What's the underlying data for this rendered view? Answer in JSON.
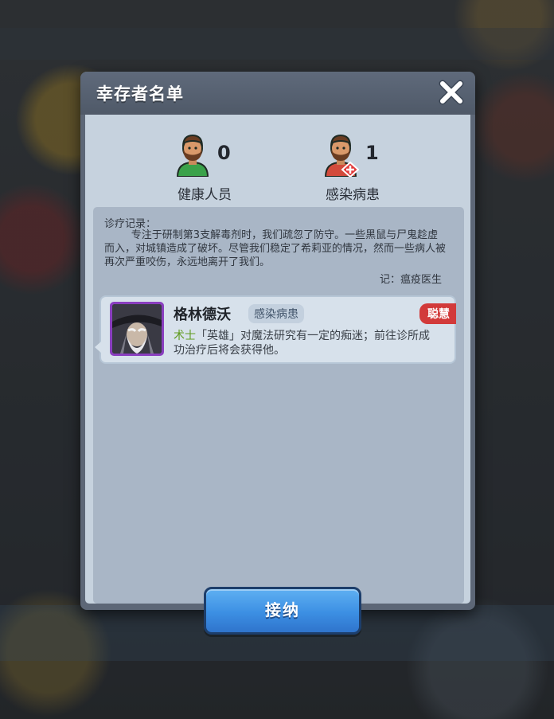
{
  "dialog": {
    "title": "幸存者名单"
  },
  "stats": {
    "healthy": {
      "count": "0",
      "label": "健康人员"
    },
    "infected": {
      "count": "1",
      "label": "感染病患"
    }
  },
  "record": {
    "heading": "诊疗记录：",
    "body": "专注于研制第3支解毒剂时，我们疏忽了防守。一些黑鼠与尸鬼趁虚而入，对城镇造成了破坏。尽管我们稳定了希莉亚的情况，然而一些病人被再次严重咬伤，永远地离开了我们。",
    "signature": "记：瘟疫医生"
  },
  "survivor": {
    "name": "格林德沃",
    "status": "感染病患",
    "trait": "聪慧",
    "class": "术士",
    "description": "「英雄」对魔法研究有一定的痴迷；前往诊所成功治疗后将会获得他。"
  },
  "actions": {
    "accept_label": "接纳"
  },
  "icons": {
    "close": "close-icon",
    "healthy": "healthy-person-icon",
    "infected": "infected-person-icon"
  },
  "colors": {
    "accept_button": "#3c8fe3",
    "trait_badge": "#d23a3a",
    "class_text": "#5f9a1e",
    "portrait_frame": "#8a3fbf"
  }
}
